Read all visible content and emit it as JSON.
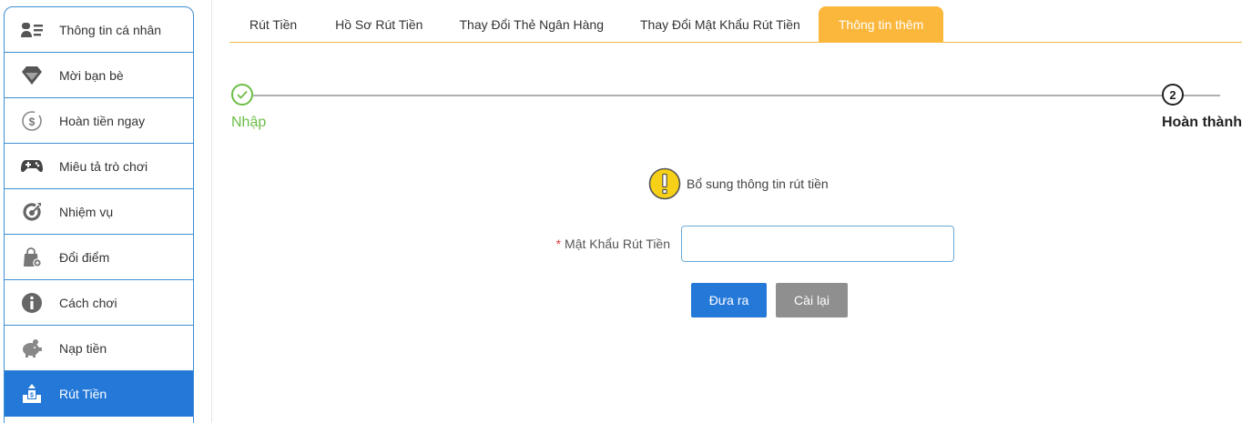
{
  "sidebar": {
    "items": [
      {
        "label": "Thông tin cá nhân",
        "icon": "profile-card-icon"
      },
      {
        "label": "Mời bạn bè",
        "icon": "diamond-icon"
      },
      {
        "label": "Hoàn tiền ngay",
        "icon": "cashback-icon"
      },
      {
        "label": "Miêu tả trò chơi",
        "icon": "gamepad-icon"
      },
      {
        "label": "Nhiệm vụ",
        "icon": "target-icon"
      },
      {
        "label": "Đổi điểm",
        "icon": "shopping-bag-icon"
      },
      {
        "label": "Cách chơi",
        "icon": "info-icon"
      },
      {
        "label": "Nạp tiền",
        "icon": "piggy-bank-icon"
      },
      {
        "label": "Rút Tiền",
        "icon": "withdraw-icon",
        "active": true
      }
    ]
  },
  "tabs": [
    {
      "label": "Rút Tiền"
    },
    {
      "label": "Hồ Sơ Rút Tiền"
    },
    {
      "label": "Thay Đổi Thẻ Ngân Hàng"
    },
    {
      "label": "Thay Đổi Mật Khẩu Rút Tiền"
    },
    {
      "label": "Thông tin thêm",
      "active": true
    }
  ],
  "stepper": {
    "step1_label": "Nhập",
    "step2_number": "2",
    "step2_label": "Hoàn thành"
  },
  "notice": {
    "text": "Bổ sung thông tin rút tiền",
    "icon": "warning-icon"
  },
  "form": {
    "required_mark": "*",
    "password_label": "Mật Khẩu Rút Tiền",
    "password_value": "",
    "submit_label": "Đưa ra",
    "reset_label": "Cài lại"
  },
  "colors": {
    "accent_blue": "#2378d8",
    "tab_active": "#fbb73c",
    "success_green": "#6cbd45",
    "reset_grey": "#8f8f8f"
  }
}
